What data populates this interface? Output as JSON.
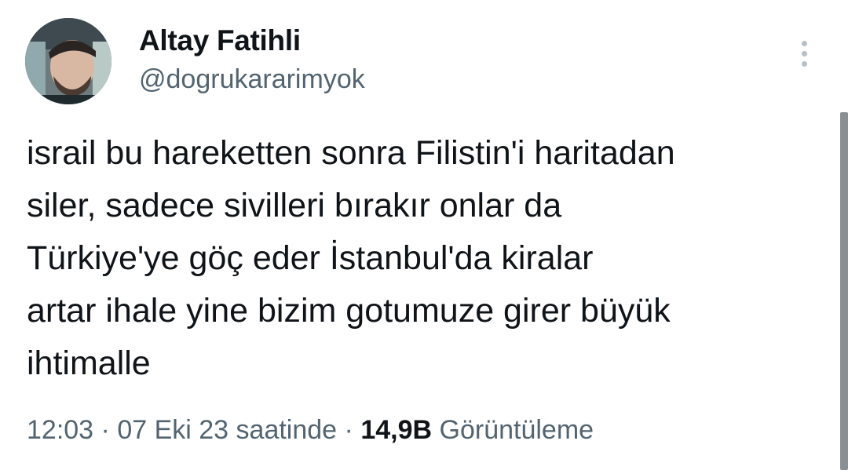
{
  "author": {
    "display_name": "Altay Fatihli",
    "handle": "@dogrukararimyok",
    "avatar_icon": "profile-photo"
  },
  "tweet": {
    "text": "israil bu hareketten sonra Filistin'i haritadan\nsiler, sadece sivilleri bırakır onlar da\nTürkiye'ye göç eder İstanbul'da kiralar\nartar ihale yine bizim gotumuze girer büyük\nihtimalle"
  },
  "meta": {
    "time": "12:03",
    "separator": "·",
    "date": "07 Eki 23 saatinde",
    "views_count": "14,9B",
    "views_label": "Görüntüleme"
  },
  "colors": {
    "text_primary": "#0f1419",
    "text_secondary": "#536471",
    "more_dots": "#b7c0c8",
    "scrollbar": "#8a8f94"
  }
}
